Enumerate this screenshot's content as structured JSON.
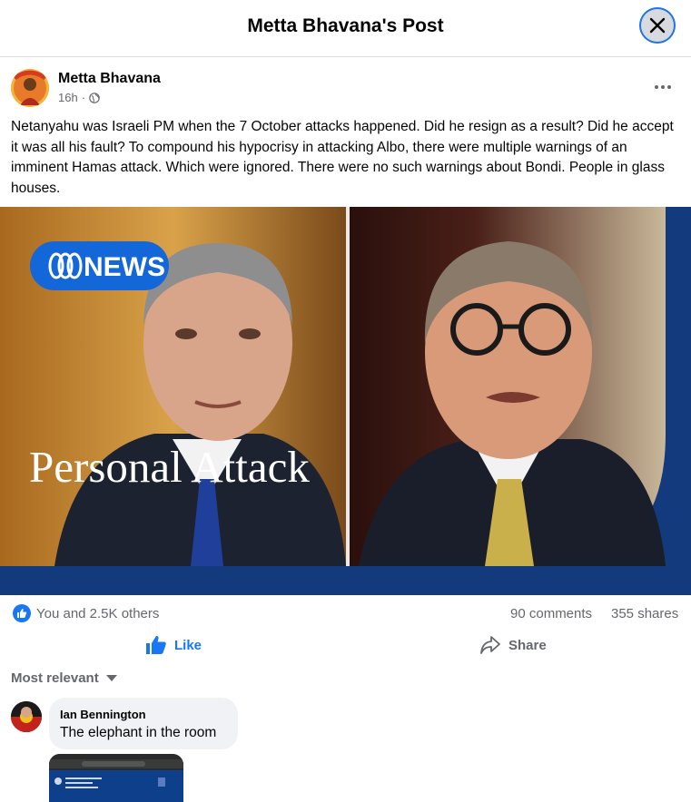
{
  "header": {
    "title": "Metta Bhavana's Post",
    "close_icon": "close-icon"
  },
  "post": {
    "author": "Metta Bhavana",
    "time": "16h",
    "audience_icon": "globe-icon",
    "more_icon": "more-dots-icon",
    "text": "Netanyahu was Israeli PM when the 7 October attacks happened. Did he resign as a result? Did he accept it was all his fault? To compound his hypocrisy in attacking Albo, there were multiple warnings of an imminent Hamas attack. Which were ignored. There were no such warnings about Bondi. People in glass houses.",
    "image": {
      "badge": "NEWS",
      "overlay_text": "Personal Attack"
    }
  },
  "reactions": {
    "summary": "You and 2.5K others",
    "comments": "90 comments",
    "shares": "355 shares"
  },
  "actions": {
    "like_label": "Like",
    "share_label": "Share"
  },
  "comments_section": {
    "sort_label": "Most relevant",
    "comments": [
      {
        "author": "Ian Bennington",
        "text": "The elephant in the room"
      }
    ]
  },
  "colors": {
    "brand_blue": "#1877f2",
    "abc_navy": "#123a7c",
    "muted": "#65676b"
  }
}
